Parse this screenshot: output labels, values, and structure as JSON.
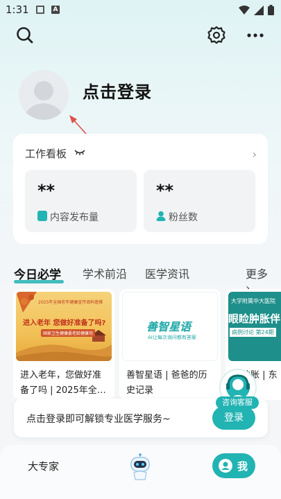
{
  "status_bar": {
    "time": "1:31"
  },
  "header": {
    "login_title": "点击登录"
  },
  "work_board": {
    "title": "工作看板",
    "stats": [
      {
        "value": "**",
        "label": "内容发布量"
      },
      {
        "value": "**",
        "label": "粉丝数"
      }
    ]
  },
  "tabs": [
    {
      "label": "今日必学",
      "active": true
    },
    {
      "label": "学术前沿",
      "active": false
    },
    {
      "label": "医学资讯",
      "active": false
    },
    {
      "label": "更多",
      "active": false
    }
  ],
  "articles": [
    {
      "title": "进入老年，您做好准备了吗 | 2025年全…",
      "image_headline": "进入老年 您做好准备了吗?",
      "image_banner": "2025年全国老年健康宣传周科普推",
      "image_sub": "国家卫生健康委老龄健康司"
    },
    {
      "title": "善智星语 | 爸爸的历史记录",
      "image_logo": "善智星语",
      "image_sub": "AI让每次询问都有答案"
    },
    {
      "title": "睑肿胀 | 东",
      "image_header": "大学附属中大医院",
      "image_headline": "眼睑肿胀伴",
      "image_sub": "病例讨论 第24期"
    }
  ],
  "customer_service": {
    "label": "咨询客服"
  },
  "login_prompt": {
    "text": "点击登录即可解锁专业医学服务~",
    "button": "登录"
  },
  "bottom_nav": {
    "expert": "大专家",
    "me": "我"
  },
  "colors": {
    "accent": "#22b3b3",
    "arrow": "#e0504a"
  }
}
